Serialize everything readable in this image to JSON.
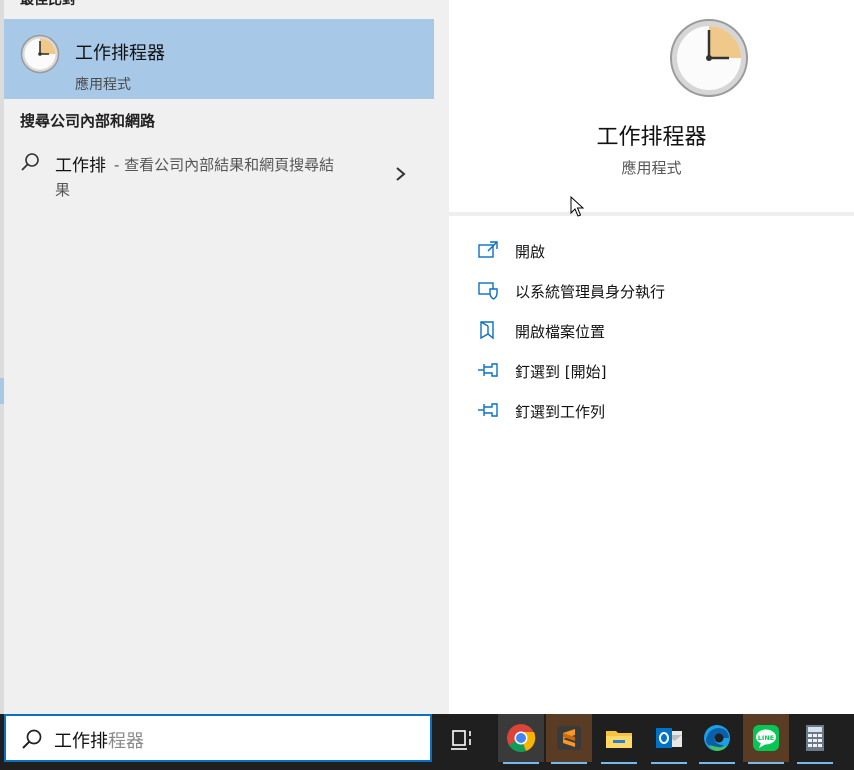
{
  "left": {
    "section_cut": "最佳比對",
    "best_match": {
      "title": "工作排程器",
      "subtitle": "應用程式",
      "icon": "clock-icon"
    },
    "web_section": "搜尋公司內部和網路",
    "web_item": {
      "query": "工作排",
      "description": "- 查看公司內部結果和網頁搜尋結",
      "description_cont": "果"
    }
  },
  "right": {
    "title": "工作排程器",
    "subtitle": "應用程式",
    "actions": [
      {
        "label": "開啟",
        "icon": "open-icon"
      },
      {
        "label": "以系統管理員身分執行",
        "icon": "shield-run-icon"
      },
      {
        "label": "開啟檔案位置",
        "icon": "file-location-icon"
      },
      {
        "label": "釘選到 [開始]",
        "icon": "pin-icon"
      },
      {
        "label": "釘選到工作列",
        "icon": "pin-icon"
      }
    ]
  },
  "search": {
    "typed": "工作排",
    "suggestion": "程器"
  },
  "taskbar": {
    "apps": [
      "task-view-icon",
      "chrome-icon",
      "sublime-icon",
      "file-explorer-icon",
      "outlook-icon",
      "edge-icon",
      "line-icon",
      "calculator-icon"
    ]
  },
  "colors": {
    "selection": "#a7c8e7",
    "accent": "#0b6fc4",
    "taskbar": "#1f1f1f"
  }
}
